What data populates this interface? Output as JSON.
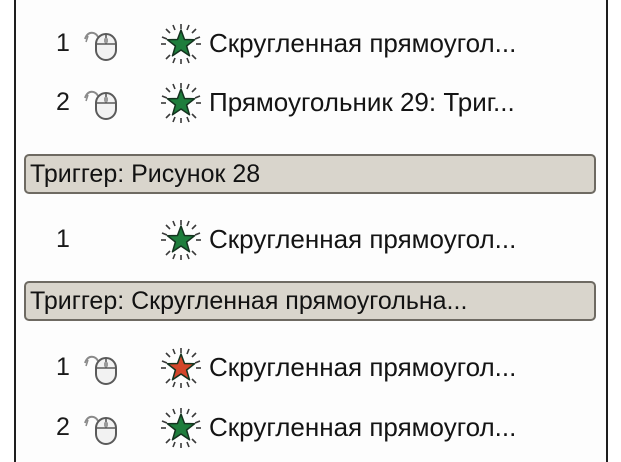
{
  "animation_list": {
    "items": [
      {
        "order": "1",
        "trigger": "on-click",
        "effect_color": "#1e7d3c",
        "label": "Скругленная прямоугол..."
      },
      {
        "order": "2",
        "trigger": "on-click",
        "effect_color": "#1e7d3c",
        "label": "Прямоугольник 29: Триг..."
      }
    ],
    "groups": [
      {
        "header": "Триггер: Рисунок 28",
        "items": [
          {
            "order": "1",
            "effect_color": "#1e7d3c",
            "label": "Скругленная прямоугол..."
          }
        ]
      },
      {
        "header": "Триггер: Скругленная прямоугольна...",
        "items": [
          {
            "order": "1",
            "trigger": "on-click",
            "effect_color": "#d2452a",
            "label": "Скругленная прямоугол..."
          },
          {
            "order": "2",
            "trigger": "on-click",
            "effect_color": "#1e7d3c",
            "label": "Скругленная прямоугол..."
          }
        ]
      }
    ]
  }
}
